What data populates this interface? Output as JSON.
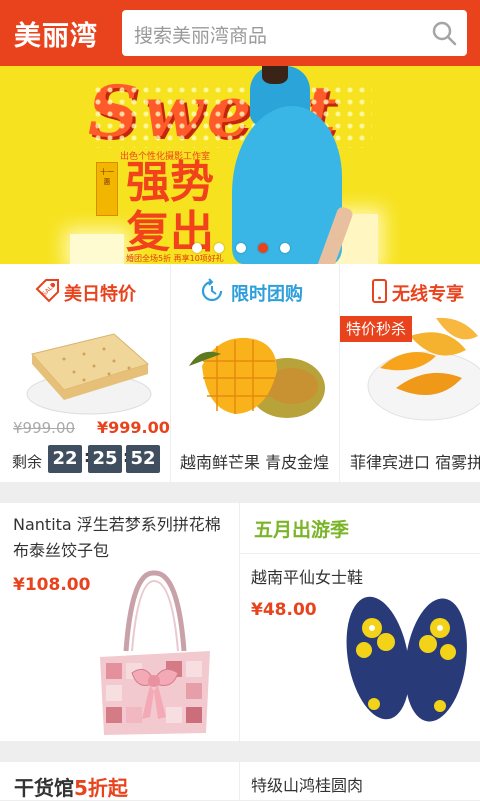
{
  "header": {
    "logo": "美丽湾",
    "search_placeholder": "搜索美丽湾商品",
    "search_icon": "search-icon"
  },
  "banner": {
    "headline": "Sweet",
    "line1": "强势",
    "line2": "复出",
    "tagline": "出色个性化摄影工作室",
    "footnote": "婚团全场5折 再享10项好礼",
    "side_tag": "十一惠",
    "dots_count": 5,
    "active_dot": 3
  },
  "promos": [
    {
      "title": "美日特价",
      "title_color": "#e8431d",
      "icon": "sale-tag-icon",
      "old_price": "¥999.00",
      "new_price": "¥999.00",
      "countdown_label": "剩余",
      "countdown": [
        "22",
        "25",
        "52"
      ]
    },
    {
      "title": "限时团购",
      "title_color": "#2f9fdc",
      "icon": "clock-icon",
      "item_name": "越南鲜芒果 青皮金煌"
    },
    {
      "title": "无线专享",
      "title_color": "#e8431d",
      "icon": "phone-icon",
      "badge": "特价秒杀",
      "item_name": "菲律宾进口 宿雾拼"
    }
  ],
  "grid": {
    "bag": {
      "title": "Nantita 浮生若梦系列拼花棉布泰丝饺子包",
      "price": "¥108.00"
    },
    "trip": {
      "title": "五月出游季"
    },
    "sandals": {
      "title": "越南平仙女士鞋",
      "price": "¥48.00"
    },
    "dry_goods": {
      "title_main": "干货馆",
      "title_accent": "5折起"
    },
    "longan": {
      "title": "特级山鸿桂圆肉"
    }
  },
  "colors": {
    "brand": "#e8431d",
    "blue": "#2f9fdc",
    "green": "#7ab427"
  }
}
